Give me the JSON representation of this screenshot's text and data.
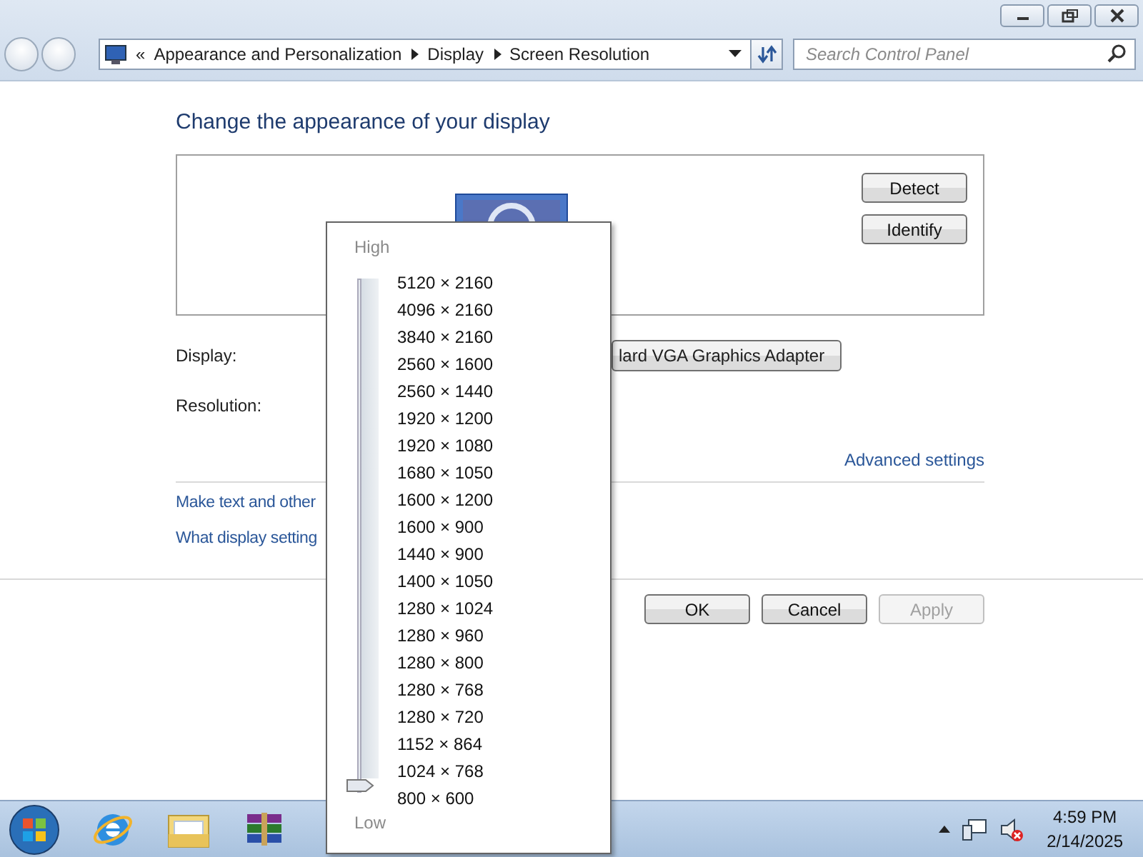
{
  "address_bar": {
    "chevron": "«",
    "breadcrumb": [
      "Appearance and Personalization",
      "Display",
      "Screen Resolution"
    ],
    "search": {
      "placeholder": "Search Control Panel"
    }
  },
  "content": {
    "heading": "Change the appearance of your display",
    "preview_buttons": [
      "Detect",
      "Identify"
    ],
    "display_label": "Display:",
    "display_value": "lard VGA Graphics Adapter",
    "resolution_label": "Resolution:",
    "advanced_link": "Advanced settings",
    "links": [
      "Make text and other",
      "What display setting"
    ],
    "buttons": [
      {
        "label": "OK",
        "disabled": false
      },
      {
        "label": "Cancel",
        "disabled": false
      },
      {
        "label": "Apply",
        "disabled": true
      }
    ]
  },
  "resolution_slider": {
    "high_label": "High",
    "low_label": "Low",
    "level": 0,
    "options": [
      "5120 × 2160",
      "4096 × 2160",
      "3840 × 2160",
      "2560 × 1600",
      "2560 × 1440",
      "1920 × 1200",
      "1920 × 1080",
      "1680 × 1050",
      "1600 × 1200",
      "1600 × 900",
      "1440 × 900",
      "1400 × 1050",
      "1280 × 1024",
      "1280 × 960",
      "1280 × 800",
      "1280 × 768",
      "1280 × 720",
      "1152 × 864",
      "1024 × 768",
      "800 × 600"
    ]
  },
  "taskbar": {
    "time": "4:59 PM",
    "date": "2/14/2025"
  }
}
